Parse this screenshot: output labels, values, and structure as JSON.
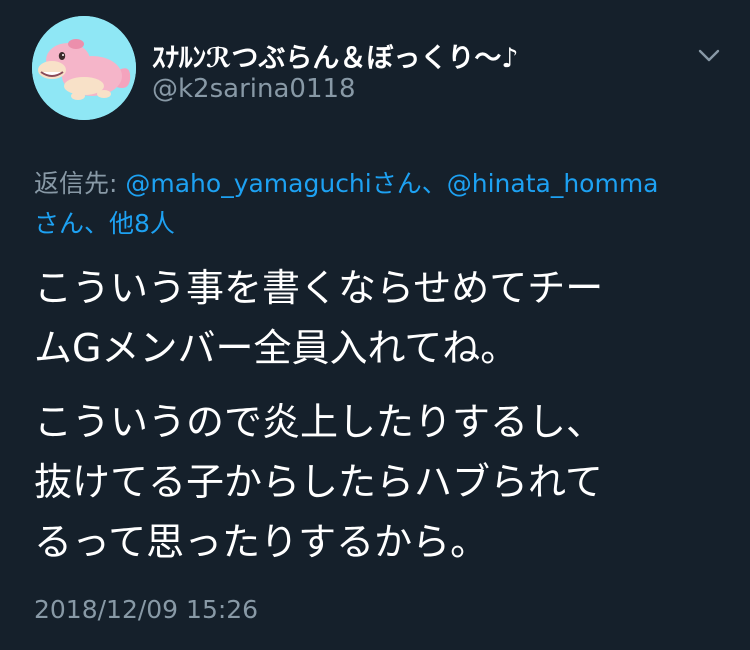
{
  "tweet": {
    "display_name": "ｽﾅﾙﾝℛつぶらん＆ぼっくり〜♪",
    "handle": "@k2sarina0118",
    "reply": {
      "prefix": "返信先: ",
      "mention_1": "@maho_yamaguchi",
      "suffix_1": "さん、",
      "mention_2": "@hinata_homma",
      "suffix_2": "さん、",
      "others": "他8人"
    },
    "body": {
      "line_1": "こういう事を書くならせめてチー",
      "line_2": "ムGメンバー全員入れてね。",
      "line_3": "こういうので炎上したりするし、",
      "line_4": "抜けてる子からしたらハブられて",
      "line_5": "るって思ったりするから。"
    },
    "timestamp": "2018/12/09 15:26"
  },
  "colors": {
    "background": "#15202b",
    "text_primary": "#ffffff",
    "text_secondary": "#8899a6",
    "link": "#1da1f2",
    "avatar_bg": "#8fe7f5"
  },
  "icons": {
    "avatar": "slowpoke-avatar-icon",
    "menu": "chevron-down-icon"
  }
}
